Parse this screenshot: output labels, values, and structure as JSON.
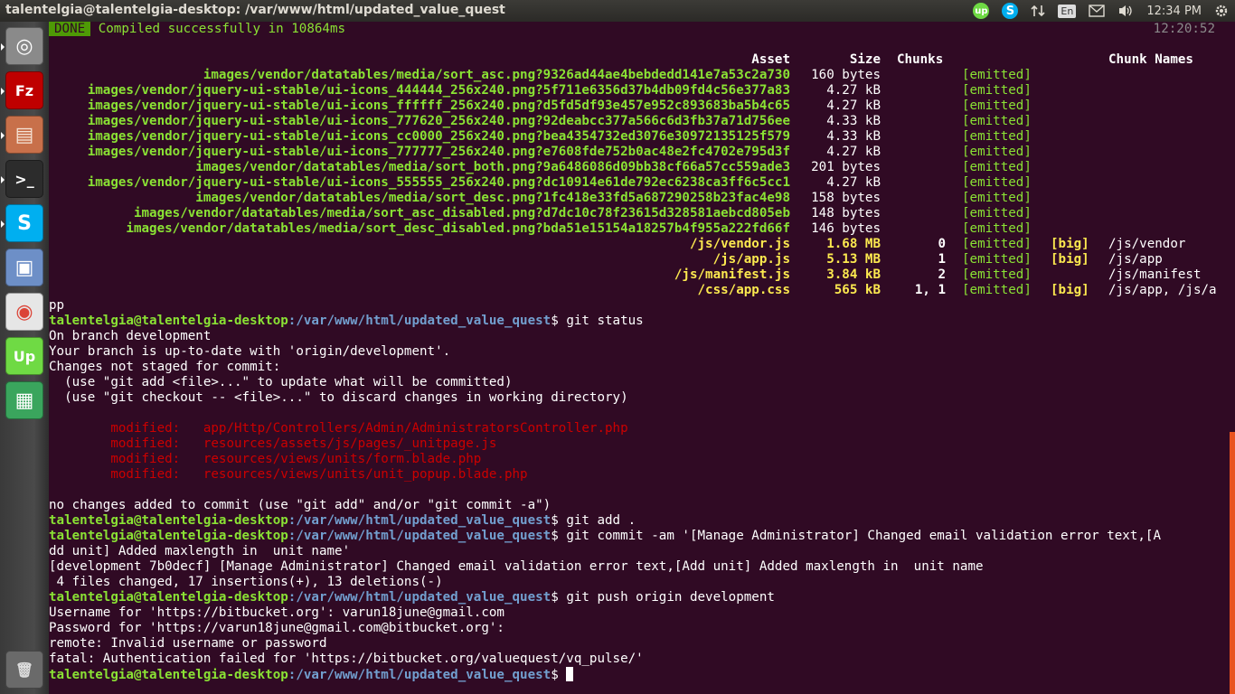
{
  "window": {
    "title": "talentelgia@talentelgia-desktop: /var/www/html/updated_value_quest"
  },
  "tray": {
    "upwork": "up",
    "skype": "S",
    "lang": "En",
    "time": "12:34 PM"
  },
  "launcher": [
    {
      "name": "ubuntu-dash-icon",
      "glyph": "◎",
      "bg": "#8a8a8a",
      "fg": "#ffffff"
    },
    {
      "name": "filezilla-icon",
      "glyph": "Fz",
      "bg": "#bf0000",
      "fg": "#ffffff"
    },
    {
      "name": "file-manager-icon",
      "glyph": "▤",
      "bg": "#c8704a",
      "fg": "#f5e3d6"
    },
    {
      "name": "terminal-icon",
      "glyph": ">_",
      "bg": "#2c2c2c",
      "fg": "#ffffff"
    },
    {
      "name": "skype-icon",
      "glyph": "S",
      "bg": "#00aff0",
      "fg": "#ffffff"
    },
    {
      "name": "virtualbox-icon",
      "glyph": "▣",
      "bg": "#6d8fc7",
      "fg": "#ffffff"
    },
    {
      "name": "chrome-icon",
      "glyph": "◉",
      "bg": "#e6e6e6",
      "fg": "#db4437"
    },
    {
      "name": "upwork-icon",
      "glyph": "Up",
      "bg": "#6fda44",
      "fg": "#ffffff"
    },
    {
      "name": "spreadsheet-icon",
      "glyph": "▦",
      "bg": "#3aa55d",
      "fg": "#ffffff"
    },
    {
      "name": "trash-icon",
      "glyph": "🗑",
      "bg": "#6a6a6a",
      "fg": "#dddddd"
    }
  ],
  "terminal": {
    "done_label": "DONE",
    "compiled_text": "Compiled successfully in 10864ms",
    "compiled_time": "12:20:52",
    "headers": {
      "asset": "Asset",
      "size": "Size",
      "chunks": "Chunks",
      "chunk_names": "Chunk Names"
    },
    "assets": [
      {
        "asset": "images/vendor/datatables/media/sort_asc.png?9326ad44ae4bebdedd141e7a53c2a730",
        "size": "160 bytes",
        "chunks": "",
        "emitted": "[emitted]",
        "big": "",
        "names": "",
        "main": false
      },
      {
        "asset": "images/vendor/jquery-ui-stable/ui-icons_444444_256x240.png?5f711e6356d37b4db09fd4c56e377a83",
        "size": "4.27 kB",
        "chunks": "",
        "emitted": "[emitted]",
        "big": "",
        "names": "",
        "main": false
      },
      {
        "asset": "images/vendor/jquery-ui-stable/ui-icons_ffffff_256x240.png?d5fd5df93e457e952c893683ba5b4c65",
        "size": "4.27 kB",
        "chunks": "",
        "emitted": "[emitted]",
        "big": "",
        "names": "",
        "main": false
      },
      {
        "asset": "images/vendor/jquery-ui-stable/ui-icons_777620_256x240.png?92deabcc377a566c6d3fb37a71d756ee",
        "size": "4.33 kB",
        "chunks": "",
        "emitted": "[emitted]",
        "big": "",
        "names": "",
        "main": false
      },
      {
        "asset": "images/vendor/jquery-ui-stable/ui-icons_cc0000_256x240.png?bea4354732ed3076e30972135125f579",
        "size": "4.33 kB",
        "chunks": "",
        "emitted": "[emitted]",
        "big": "",
        "names": "",
        "main": false
      },
      {
        "asset": "images/vendor/jquery-ui-stable/ui-icons_777777_256x240.png?e7608fde752b0ac48e2fc4702e795d3f",
        "size": "4.27 kB",
        "chunks": "",
        "emitted": "[emitted]",
        "big": "",
        "names": "",
        "main": false
      },
      {
        "asset": "images/vendor/datatables/media/sort_both.png?9a6486086d09bb38cf66a57cc559ade3",
        "size": "201 bytes",
        "chunks": "",
        "emitted": "[emitted]",
        "big": "",
        "names": "",
        "main": false
      },
      {
        "asset": "images/vendor/jquery-ui-stable/ui-icons_555555_256x240.png?dc10914e61de792ec6238ca3ff6c5cc1",
        "size": "4.27 kB",
        "chunks": "",
        "emitted": "[emitted]",
        "big": "",
        "names": "",
        "main": false
      },
      {
        "asset": "images/vendor/datatables/media/sort_desc.png?1fc418e33fd5a687290258b23fac4e98",
        "size": "158 bytes",
        "chunks": "",
        "emitted": "[emitted]",
        "big": "",
        "names": "",
        "main": false
      },
      {
        "asset": "images/vendor/datatables/media/sort_asc_disabled.png?d7dc10c78f23615d328581aebcd805eb",
        "size": "148 bytes",
        "chunks": "",
        "emitted": "[emitted]",
        "big": "",
        "names": "",
        "main": false
      },
      {
        "asset": "images/vendor/datatables/media/sort_desc_disabled.png?bda51e15154a18257b4f955a222fd66f",
        "size": "146 bytes",
        "chunks": "",
        "emitted": "[emitted]",
        "big": "",
        "names": "",
        "main": false
      },
      {
        "asset": "/js/vendor.js",
        "size": "1.68 MB",
        "chunks": "0",
        "emitted": "[emitted]",
        "big": "[big]",
        "names": "/js/vendor",
        "main": true
      },
      {
        "asset": "/js/app.js",
        "size": "5.13 MB",
        "chunks": "1",
        "emitted": "[emitted]",
        "big": "[big]",
        "names": "/js/app",
        "main": true
      },
      {
        "asset": "/js/manifest.js",
        "size": "3.84 kB",
        "chunks": "2",
        "emitted": "[emitted]",
        "big": "",
        "names": "/js/manifest",
        "main": true
      },
      {
        "asset": "/css/app.css",
        "size": "565 kB",
        "chunks": "1, 1",
        "emitted": "[emitted]",
        "big": "[big]",
        "names": "/js/app, /js/a",
        "main": true
      }
    ],
    "wrap_pp": "pp",
    "prompt_user": "talentelgia@talentelgia-desktop",
    "prompt_path": ":/var/www/html/updated_value_quest",
    "lines": [
      {
        "t": "prompt",
        "cmd": "git status"
      },
      {
        "t": "out",
        "text": "On branch development"
      },
      {
        "t": "out",
        "text": "Your branch is up-to-date with 'origin/development'."
      },
      {
        "t": "out",
        "text": "Changes not staged for commit:"
      },
      {
        "t": "out",
        "text": "  (use \"git add <file>...\" to update what will be committed)"
      },
      {
        "t": "out",
        "text": "  (use \"git checkout -- <file>...\" to discard changes in working directory)"
      },
      {
        "t": "out",
        "text": ""
      },
      {
        "t": "mod",
        "text": "\tmodified:   app/Http/Controllers/Admin/AdministratorsController.php"
      },
      {
        "t": "mod",
        "text": "\tmodified:   resources/assets/js/pages/_unitpage.js"
      },
      {
        "t": "mod",
        "text": "\tmodified:   resources/views/units/form.blade.php"
      },
      {
        "t": "mod",
        "text": "\tmodified:   resources/views/units/unit_popup.blade.php"
      },
      {
        "t": "out",
        "text": ""
      },
      {
        "t": "out",
        "text": "no changes added to commit (use \"git add\" and/or \"git commit -a\")"
      },
      {
        "t": "prompt",
        "cmd": "git add ."
      },
      {
        "t": "prompt",
        "cmd": "git commit -am '[Manage Administrator] Changed email validation error text,[A"
      },
      {
        "t": "out",
        "text": "dd unit] Added maxlength in  unit name'"
      },
      {
        "t": "out",
        "text": "[development 7b0decf] [Manage Administrator] Changed email validation error text,[Add unit] Added maxlength in  unit name"
      },
      {
        "t": "out",
        "text": " 4 files changed, 17 insertions(+), 13 deletions(-)"
      },
      {
        "t": "prompt",
        "cmd": "git push origin development"
      },
      {
        "t": "out",
        "text": "Username for 'https://bitbucket.org': varun18june@gmail.com"
      },
      {
        "t": "out",
        "text": "Password for 'https://varun18june@gmail.com@bitbucket.org':"
      },
      {
        "t": "out",
        "text": "remote: Invalid username or password"
      },
      {
        "t": "out",
        "text": "fatal: Authentication failed for 'https://bitbucket.org/valuequest/vq_pulse/'"
      },
      {
        "t": "prompt",
        "cmd": "",
        "cursor": true
      }
    ]
  }
}
